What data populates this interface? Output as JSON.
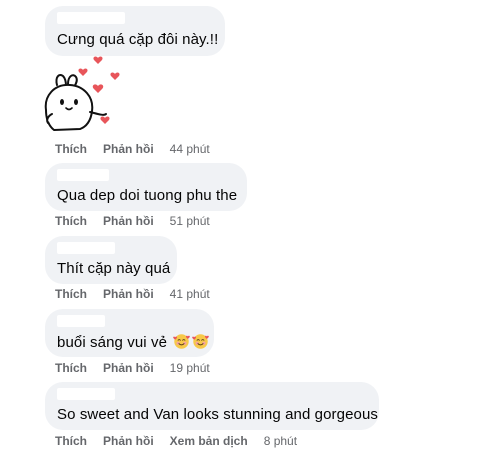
{
  "comments": [
    {
      "text": "Cưng quá cặp đôi này.!!",
      "sticker_icon": "bunny-hearts-sticker",
      "actions": {
        "like": "Thích",
        "reply": "Phản hồi",
        "time": "44 phút"
      }
    },
    {
      "text": "Qua dep doi tuong phu the",
      "actions": {
        "like": "Thích",
        "reply": "Phản hồi",
        "time": "51 phút"
      }
    },
    {
      "text": "Thít cặp này quá",
      "actions": {
        "like": "Thích",
        "reply": "Phản hồi",
        "time": "41 phút"
      }
    },
    {
      "text": "buổi sáng vui vẻ",
      "emoji_icons": [
        "smiling-face-with-hearts-emoji",
        "smiling-face-with-hearts-emoji"
      ],
      "actions": {
        "like": "Thích",
        "reply": "Phản hồi",
        "time": "19 phút"
      }
    },
    {
      "text": "So sweet and Van looks stunning and gorgeous",
      "actions": {
        "like": "Thích",
        "reply": "Phản hồi",
        "translate": "Xem bản dịch",
        "time": "8 phút"
      }
    }
  ],
  "colors": {
    "bubble_bg": "#f0f2f5",
    "text": "#050505",
    "secondary_text": "#65676b",
    "heart": "#e8555a"
  }
}
